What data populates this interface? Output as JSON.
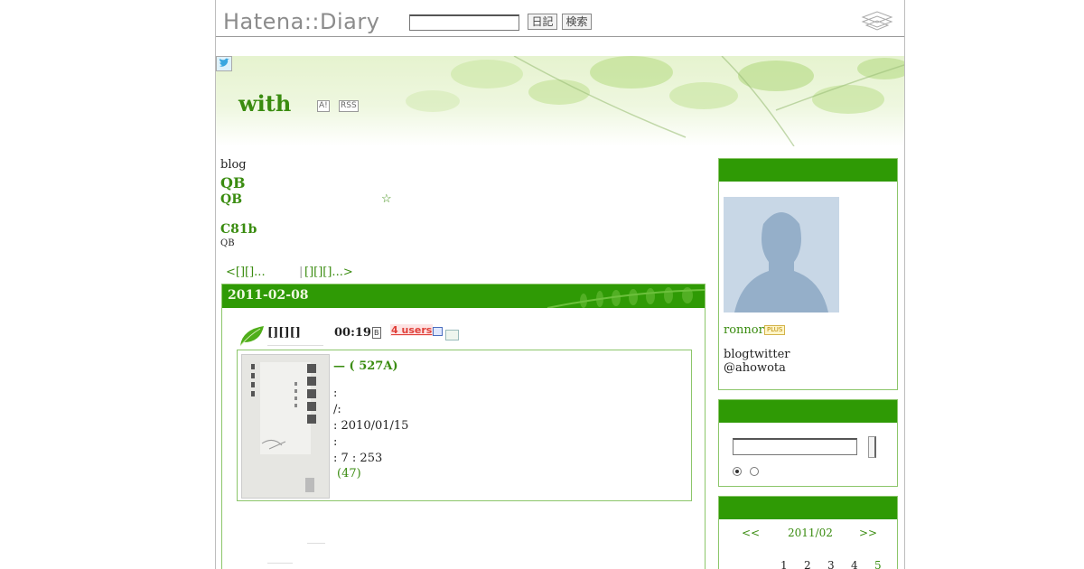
{
  "header": {
    "logo": "Hatena::Diary",
    "search_value": "",
    "diary_button": "日記",
    "search_button": "検索",
    "hatena_icon": "hatena-diamond-icon"
  },
  "banner": {
    "title": "with",
    "antenna_label": "A!",
    "rss_label": "RSS",
    "twitter_icon": "twitter-bird-icon"
  },
  "description": {
    "line1": "blog",
    "qb1": "QB",
    "qb2": "QB",
    "star": "☆",
    "c81b": "C81b",
    "qb3": "QB"
  },
  "nav": {
    "prev": "<[][]...",
    "separator": "|",
    "next": "[][][]...>"
  },
  "day": {
    "date": "2011-02-08",
    "entry": {
      "title": "[][][]",
      "time": "00:19",
      "hatebu_label": "B",
      "users": "4 users",
      "book": {
        "title": "— ( 527A)",
        "line1": ":",
        "line2": "/:",
        "line3": ":    2010/01/15",
        "line4": ":",
        "line5": ": 7        : 253",
        "link": "(47)"
      }
    }
  },
  "sidebar": {
    "profile": {
      "username": "ronnor",
      "plus_badge": "PLUS",
      "bio_line1": "blogtwitter",
      "bio_line2": "@ahowota"
    },
    "search": {
      "value": ""
    },
    "calendar": {
      "prev": "<<",
      "month": "2011/02",
      "next": ">>",
      "days": [
        "1",
        "2",
        "3",
        "4",
        "5"
      ]
    }
  },
  "colors": {
    "accent_green": "#2f9a05",
    "link_green": "#3a8c10",
    "border_green": "#8cc66a"
  }
}
